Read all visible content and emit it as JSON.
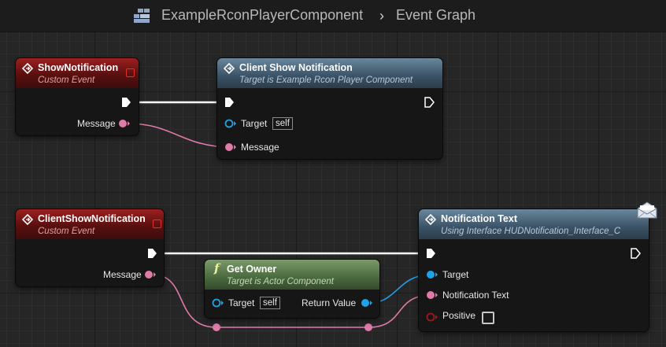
{
  "breadcrumb": {
    "blueprint": "ExampleRconPlayerComponent",
    "separator": "›",
    "graph": "Event Graph"
  },
  "nodes": {
    "show_notification": {
      "title": "ShowNotification",
      "subtitle": "Custom Event",
      "pin_message": "Message"
    },
    "client_show_notification_call": {
      "title": "Client Show Notification",
      "subtitle": "Target is Example Rcon Player Component",
      "pin_target": "Target",
      "target_default": "self",
      "pin_message": "Message"
    },
    "client_show_notification_event": {
      "title": "ClientShowNotification",
      "subtitle": "Custom Event",
      "pin_message": "Message"
    },
    "get_owner": {
      "title": "Get Owner",
      "subtitle": "Target is Actor Component",
      "pin_target": "Target",
      "target_default": "self",
      "pin_return": "Return Value"
    },
    "notification_text": {
      "title": "Notification Text",
      "subtitle": "Using Interface HUDNotification_Interface_C",
      "pin_target": "Target",
      "pin_notification_text": "Notification Text",
      "pin_positive": "Positive"
    }
  },
  "colors": {
    "event_header": "#9c1f1f",
    "call_header": "#3b5266",
    "pure_header": "#4a6a3e",
    "exec_wire": "#ffffff",
    "string_pin": "#e07aa8",
    "object_pin": "#1fa3e8",
    "bool_pin": "#a01818"
  },
  "icons": {
    "blueprint": "blueprint-class-icon",
    "event": "event-diamond-icon",
    "function": "function-f-icon",
    "message": "interface-message-icon"
  }
}
